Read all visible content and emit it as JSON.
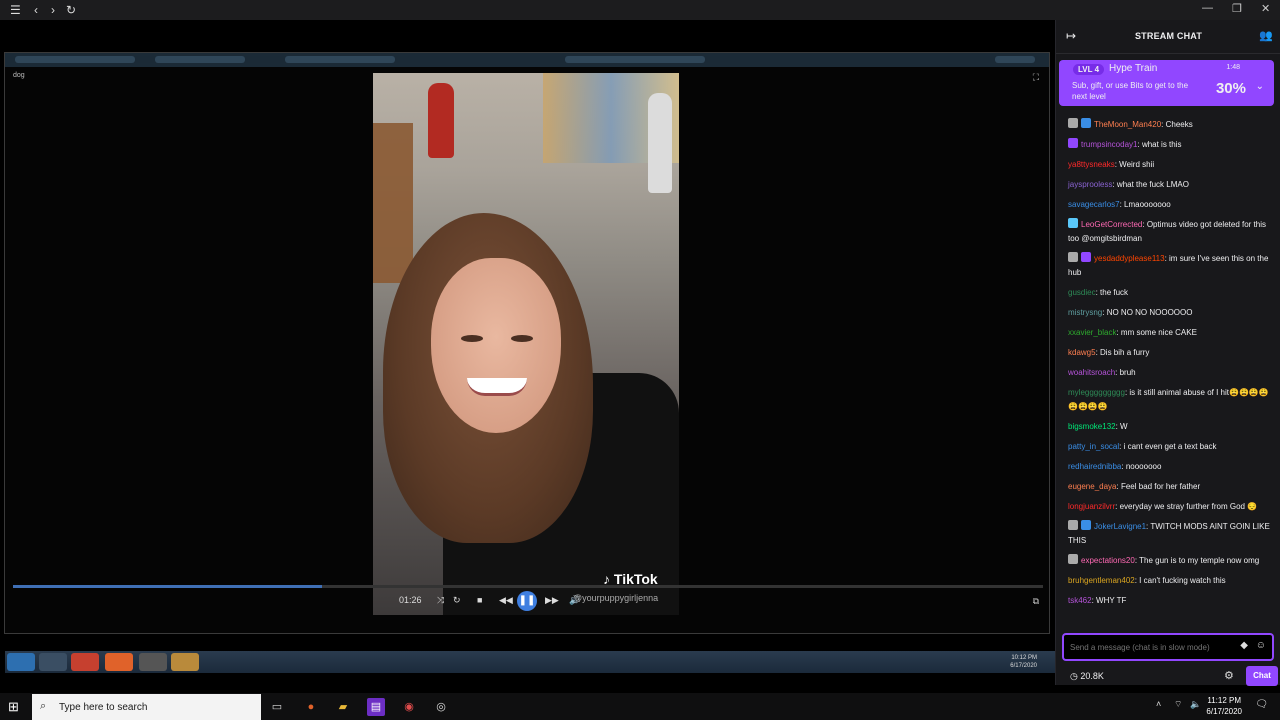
{
  "browser": {
    "icons": [
      "menu-icon",
      "back-icon",
      "forward-icon",
      "refresh-icon"
    ]
  },
  "stream": {
    "inner_window_label": "dog",
    "video": {
      "tiktok_logo": "TikTok",
      "tiktok_user": "@yourpuppygirljenna",
      "time": "01:26",
      "progress_fraction": 0.3
    },
    "inner_clock": {
      "time": "10:12 PM",
      "date": "6/17/2020"
    }
  },
  "chat": {
    "title": "STREAM CHAT",
    "hype_train": {
      "level": "LVL 4",
      "title": "Hype Train",
      "description": "Sub, gift, or use Bits to get to the next level",
      "timer": "1:48",
      "percent": "30%"
    },
    "messages": [
      {
        "user": "TheMoon_Man420",
        "color": "#ff7f50",
        "text": "Cheeks",
        "badges": [
          "#aaa",
          "#3a8ee6"
        ]
      },
      {
        "user": "trumpsincoday1",
        "color": "#b553d9",
        "text": "what is this",
        "badges": [
          "#9147ff"
        ]
      },
      {
        "user": "ya8ttysneaks",
        "color": "#ff2a2a",
        "text": "Weird shii",
        "badges": []
      },
      {
        "user": "jaysprooless",
        "color": "#8a63d2",
        "text": "what the fuck LMAO",
        "badges": []
      },
      {
        "user": "savagecarlos7",
        "color": "#3a8ee6",
        "text": "Lmaooooooo",
        "badges": []
      },
      {
        "user": "LeoGetCorrected",
        "color": "#ff69b4",
        "text": "Optimus video got deleted for this too @omgitsbirdman",
        "badges": [
          "#5ac8fa"
        ]
      },
      {
        "user": "yesdaddyplease113",
        "color": "#ff4500",
        "text": "im sure I've seen this on the hub",
        "badges": [
          "#aaa",
          "#9147ff"
        ]
      },
      {
        "user": "gusdiec",
        "color": "#2e8b57",
        "text": "the fuck",
        "badges": []
      },
      {
        "user": "mistrysng",
        "color": "#5f9ea0",
        "text": "NO NO NO NOOOOOO",
        "badges": []
      },
      {
        "user": "xxavier_black",
        "color": "#2eaa2e",
        "text": "mm some nice CAKE",
        "badges": []
      },
      {
        "user": "kdawg5",
        "color": "#ff7f50",
        "text": "Dis bih a furry",
        "badges": []
      },
      {
        "user": "woahitsroach",
        "color": "#b553d9",
        "text": "bruh",
        "badges": []
      },
      {
        "user": "myleggggggggg",
        "color": "#2e8b57",
        "text": "is it still animal abuse of I hit😩😩😩😩😩😩😩😩",
        "badges": []
      },
      {
        "user": "bigsmoke132",
        "color": "#00e676",
        "text": "W",
        "badges": []
      },
      {
        "user": "patty_in_socal",
        "color": "#3a8ee6",
        "text": "i cant even get a text back",
        "badges": []
      },
      {
        "user": "redhairednibba",
        "color": "#3a8ee6",
        "text": "nooooooo",
        "badges": []
      },
      {
        "user": "eugene_daya",
        "color": "#ff7f50",
        "text": "Feel bad for her father",
        "badges": []
      },
      {
        "user": "longjuanzilvrr",
        "color": "#ff2a2a",
        "text": "everyday we stray further from God 😔",
        "badges": []
      },
      {
        "user": "JokerLavigne1",
        "color": "#3a8ee6",
        "text": "TWITCH MODS AINT GOIN LIKE THIS",
        "badges": [
          "#aaa",
          "#3a8ee6"
        ]
      },
      {
        "user": "expectations20",
        "color": "#ff69b4",
        "text": "The gun is to my temple now omg",
        "badges": [
          "#aaa"
        ]
      },
      {
        "user": "bruhgentleman402",
        "color": "#daa520",
        "text": "I can't fucking watch this",
        "badges": []
      },
      {
        "user": "tsk462",
        "color": "#b553d9",
        "text": "WHY TF",
        "badges": []
      }
    ],
    "input_placeholder": "Send a message (chat is in slow mode)",
    "viewers": "20.8K",
    "chat_button": "Chat"
  },
  "taskbar": {
    "search_placeholder": "Type here to search",
    "time": "11:12 PM",
    "date": "6/17/2020"
  }
}
